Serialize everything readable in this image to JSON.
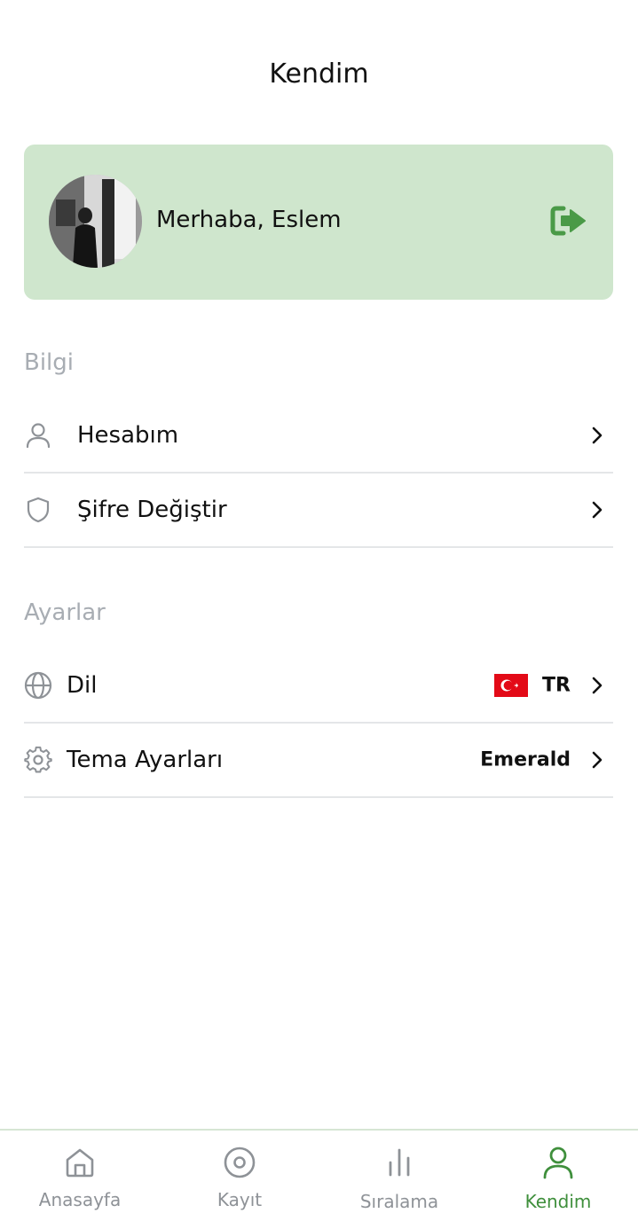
{
  "header": {
    "title": "Kendim"
  },
  "profile": {
    "greeting": "Merhaba, Eslem",
    "avatar_icon": "user-photo",
    "logout_icon": "logout-icon"
  },
  "sections": {
    "bilgi": {
      "title": "Bilgi",
      "items": [
        {
          "label": "Hesabım",
          "icon": "user-icon"
        },
        {
          "label": "Şifre Değiştir",
          "icon": "shield-icon"
        }
      ]
    },
    "ayarlar": {
      "title": "Ayarlar",
      "items": [
        {
          "label": "Dil",
          "icon": "globe-icon",
          "value": "TR",
          "flag": "turkey-flag"
        },
        {
          "label": "Tema Ayarları",
          "icon": "gear-icon",
          "value": "Emerald"
        }
      ]
    }
  },
  "bottom_nav": {
    "items": [
      {
        "label": "Anasayfa",
        "icon": "home-icon",
        "active": false
      },
      {
        "label": "Kayıt",
        "icon": "record-icon",
        "active": false
      },
      {
        "label": "Sıralama",
        "icon": "bar-chart-icon",
        "active": false
      },
      {
        "label": "Kendim",
        "icon": "user-icon",
        "active": true
      }
    ]
  },
  "colors": {
    "accent": "#3f8f3c",
    "card_background": "#cfe6cd",
    "section_title": "#a8adb3",
    "inactive_nav": "#8e9297",
    "divider": "#e4e6e8"
  }
}
